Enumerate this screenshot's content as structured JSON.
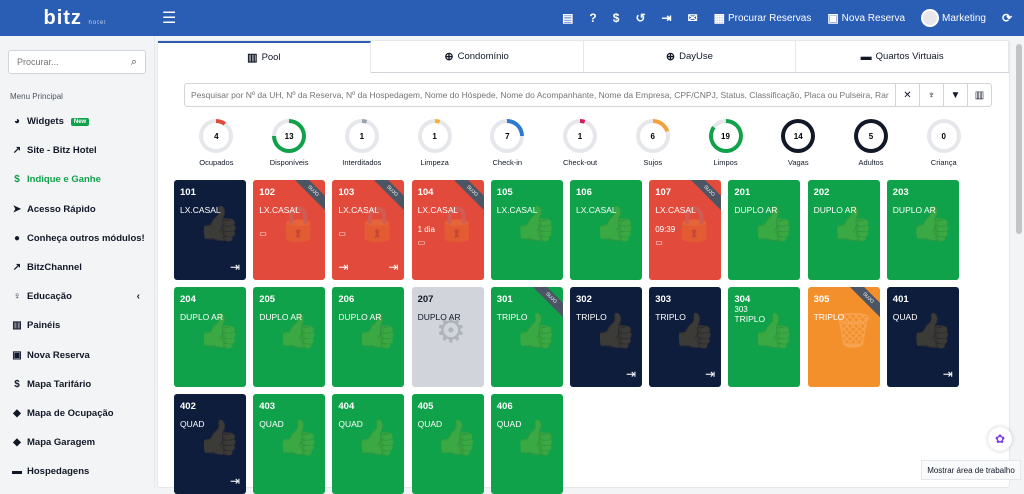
{
  "topbar": {
    "logo": "bitz",
    "logo_small": "hotel",
    "icons": [
      "card-icon",
      "help-icon",
      "dollar-icon",
      "history-icon",
      "login-icon",
      "mail-icon"
    ],
    "procurar_reservas": "Procurar Reservas",
    "nova_reserva": "Nova Reserva",
    "user": "Marketing"
  },
  "sidebar": {
    "search_placeholder": "Procurar...",
    "menu_title": "Menu Principal",
    "items": [
      {
        "label": "Widgets",
        "icon": "widgets-icon",
        "badge": "New"
      },
      {
        "label": "Site - Bitz Hotel",
        "icon": "external-link-icon"
      },
      {
        "label": "Indique e Ganhe",
        "icon": "hand-money-icon"
      },
      {
        "label": "Acesso Rápido",
        "icon": "paper-plane-icon"
      },
      {
        "label": "Conheça outros módulos!",
        "icon": "info-icon"
      },
      {
        "label": "BitzChannel",
        "icon": "external-link-icon"
      },
      {
        "label": "Educação",
        "icon": "education-icon"
      },
      {
        "label": "Painéis",
        "icon": "building-icon"
      },
      {
        "label": "Nova Reserva",
        "icon": "calendar-icon"
      },
      {
        "label": "Mapa Tarifário",
        "icon": "dollar-icon"
      },
      {
        "label": "Mapa de Ocupação",
        "icon": "tags-icon"
      },
      {
        "label": "Mapa Garagem",
        "icon": "tags-icon"
      },
      {
        "label": "Hospedagens",
        "icon": "bed-icon"
      }
    ]
  },
  "tabs": [
    {
      "label": "Pool",
      "icon": "building-icon"
    },
    {
      "label": "Condomínio",
      "icon": "plus-circle-icon"
    },
    {
      "label": "DayUse",
      "icon": "plus-circle-icon"
    },
    {
      "label": "Quartos Virtuais",
      "icon": "bed-icon"
    }
  ],
  "filter_placeholder": "Pesquisar por Nº da UH, Nº da Reserva, Nº da Hospedagem, Nome do Hóspede, Nome do Acompanhante, Nome da Empresa, CPF/CNPJ, Status, Classificação, Placa ou Pulseira, Rar",
  "stats": [
    {
      "value": "4",
      "label": "Ocupados",
      "color": "#e24b3b",
      "pct": 10
    },
    {
      "value": "13",
      "label": "Disponíveis",
      "color": "#10a24a",
      "pct": 75
    },
    {
      "value": "1",
      "label": "Interditados",
      "color": "#9ca3af",
      "pct": 5
    },
    {
      "value": "1",
      "label": "Limpeza",
      "color": "#f4b23b",
      "pct": 5
    },
    {
      "value": "7",
      "label": "Check-in",
      "color": "#2a7ad4",
      "pct": 25
    },
    {
      "value": "1",
      "label": "Check-out",
      "color": "#d81b60",
      "pct": 5
    },
    {
      "value": "6",
      "label": "Sujos",
      "color": "#f4a23b",
      "pct": 20
    },
    {
      "value": "19",
      "label": "Limpos",
      "color": "#10a24a",
      "pct": 85
    },
    {
      "value": "14",
      "label": "Vagas",
      "color": "#111827",
      "pct": 100
    },
    {
      "value": "5",
      "label": "Adultos",
      "color": "#111827",
      "pct": 100
    },
    {
      "value": "0",
      "label": "Criança",
      "color": "#e5e7eb",
      "pct": 0
    }
  ],
  "rooms": [
    {
      "num": "101",
      "type": "LX.CASAL",
      "status": "navy",
      "bottom_right": "logout-icon"
    },
    {
      "num": "102",
      "type": "LX.CASAL",
      "status": "red",
      "ribbon": "SUJO",
      "extra": "money-icon"
    },
    {
      "num": "103",
      "type": "LX.CASAL",
      "status": "red",
      "ribbon": "SUJO",
      "extra": "money-icon",
      "bottom_left": "login-icon",
      "bottom_right": "logout-icon"
    },
    {
      "num": "104",
      "type": "LX.CASAL",
      "status": "red",
      "ribbon": "SUJO",
      "extra_text": "1 dia"
    },
    {
      "num": "105",
      "type": "LX.CASAL",
      "status": "green"
    },
    {
      "num": "106",
      "type": "LX.CASAL",
      "status": "green"
    },
    {
      "num": "107",
      "type": "LX.CASAL",
      "status": "red",
      "ribbon": "SUJO",
      "extra_text": "09:39"
    },
    {
      "num": "201",
      "type": "DUPLO AR",
      "status": "green"
    },
    {
      "num": "202",
      "type": "DUPLO AR",
      "status": "green"
    },
    {
      "num": "203",
      "type": "DUPLO AR",
      "status": "green"
    },
    {
      "num": "204",
      "type": "DUPLO AR",
      "status": "green"
    },
    {
      "num": "205",
      "type": "DUPLO AR",
      "status": "green"
    },
    {
      "num": "206",
      "type": "DUPLO AR",
      "status": "green"
    },
    {
      "num": "207",
      "type": "DUPLO AR",
      "status": "grey"
    },
    {
      "num": "301",
      "type": "TRIPLO",
      "status": "green",
      "ribbon": "SUJO"
    },
    {
      "num": "302",
      "type": "TRIPLO",
      "status": "navy",
      "bottom_right": "logout-icon"
    },
    {
      "num": "303",
      "type": "TRIPLO",
      "status": "navy",
      "bottom_right": "logout-icon"
    },
    {
      "num": "304",
      "type": "TRIPLO",
      "status": "green",
      "extra_text": "303"
    },
    {
      "num": "305",
      "type": "TRIPLO",
      "status": "orange",
      "ribbon": "SUJO"
    },
    {
      "num": "401",
      "type": "QUAD",
      "status": "navy",
      "bottom_right": "logout-icon"
    },
    {
      "num": "402",
      "type": "QUAD",
      "status": "navy",
      "bottom_right": "logout-icon"
    },
    {
      "num": "403",
      "type": "QUAD",
      "status": "green"
    },
    {
      "num": "404",
      "type": "QUAD",
      "status": "green"
    },
    {
      "num": "405",
      "type": "QUAD",
      "status": "green"
    },
    {
      "num": "406",
      "type": "QUAD",
      "status": "green"
    }
  ],
  "tooltip": "Mostrar área de trabalho"
}
